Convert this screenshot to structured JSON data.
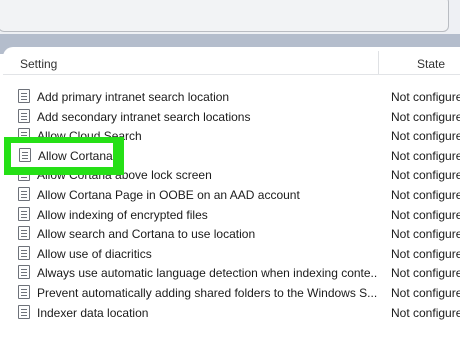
{
  "header": {
    "setting_label": "Setting",
    "state_label": "State"
  },
  "rows": [
    {
      "name": "Add primary intranet search location",
      "state": "Not configured"
    },
    {
      "name": "Add secondary intranet search locations",
      "state": "Not configured"
    },
    {
      "name": "Allow Cloud Search",
      "state": "Not configured"
    },
    {
      "name": "Allow Cortana",
      "state": "Not configured"
    },
    {
      "name": "Allow Cortana above lock screen",
      "state": "Not configured"
    },
    {
      "name": "Allow Cortana Page in OOBE on an AAD account",
      "state": "Not configured"
    },
    {
      "name": "Allow indexing of encrypted files",
      "state": "Not configured"
    },
    {
      "name": "Allow search and Cortana to use location",
      "state": "Not configured"
    },
    {
      "name": "Allow use of diacritics",
      "state": "Not configured"
    },
    {
      "name": "Always use automatic language detection when indexing conte...",
      "state": "Not configured"
    },
    {
      "name": "Prevent automatically adding shared folders to the Windows S...",
      "state": "Not configured"
    },
    {
      "name": "Indexer data location",
      "state": "Not configured"
    }
  ],
  "highlight": {
    "label": "Allow Cortana",
    "color": "#25e016"
  },
  "icons": {
    "policy_setting": "policy-setting-icon"
  }
}
